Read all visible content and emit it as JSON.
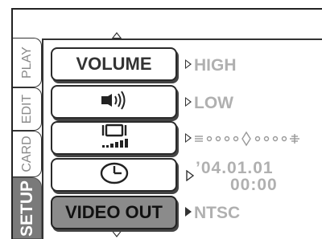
{
  "tabs": [
    {
      "label": "PLAY"
    },
    {
      "label": "EDIT"
    },
    {
      "label": "CARD"
    },
    {
      "label": "SETUP",
      "active": true
    }
  ],
  "menu": {
    "items": [
      {
        "label": "VOLUME",
        "value": "HIGH"
      },
      {
        "icon": "speaker-icon",
        "value": "LOW"
      },
      {
        "icon": "screen-brightness-icon",
        "value": "",
        "slider_steps": 11,
        "slider_level": 0.5
      },
      {
        "icon": "clock-icon",
        "date": "’04.01.01",
        "time": "00:00"
      },
      {
        "label": "VIDEO OUT",
        "value": "NTSC",
        "selected": true
      }
    ]
  },
  "colors": {
    "selected_bg": "#8b8b8b",
    "setup_tab_bg": "#7a7a7a",
    "value_text": "#b0b0b0"
  }
}
